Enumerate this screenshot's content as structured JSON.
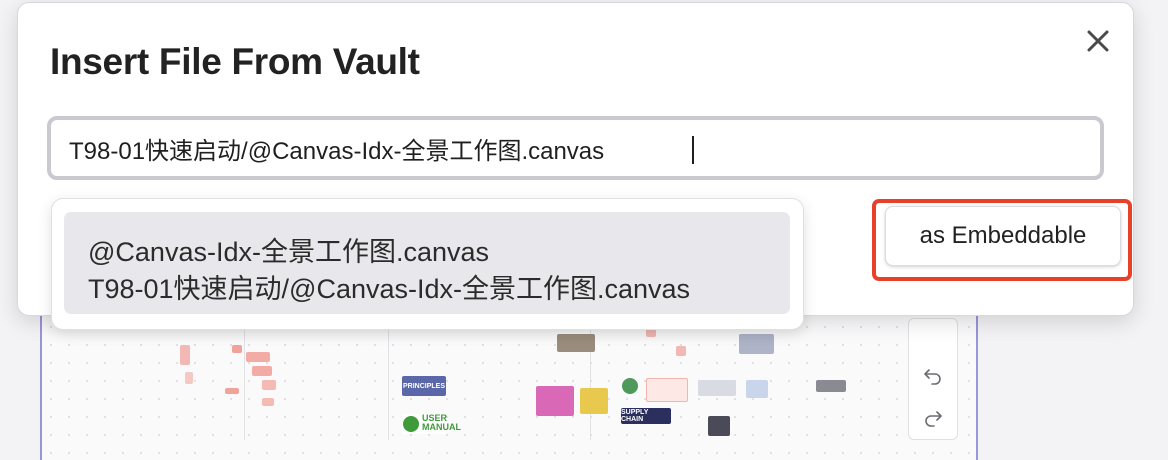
{
  "dialog": {
    "title": "Insert File From Vault",
    "close_icon": "close-icon"
  },
  "search": {
    "value": "T98-01快速启动/@Canvas-Idx-全景工作图.canvas"
  },
  "suggestions": [
    {
      "name": "@Canvas-Idx-全景工作图.canvas",
      "path": "T98-01快速启动/@Canvas-Idx-全景工作图.canvas"
    }
  ],
  "embed_button": {
    "label": "as Embeddable"
  },
  "highlight_color": "#e9402a",
  "background_canvas": {
    "thumbnail_labels": [
      "PRINCIPLES",
      "USER",
      "MANUAL",
      "SUPPLY CHAIN"
    ],
    "toolbar_icons": [
      "undo-icon",
      "redo-icon"
    ]
  }
}
